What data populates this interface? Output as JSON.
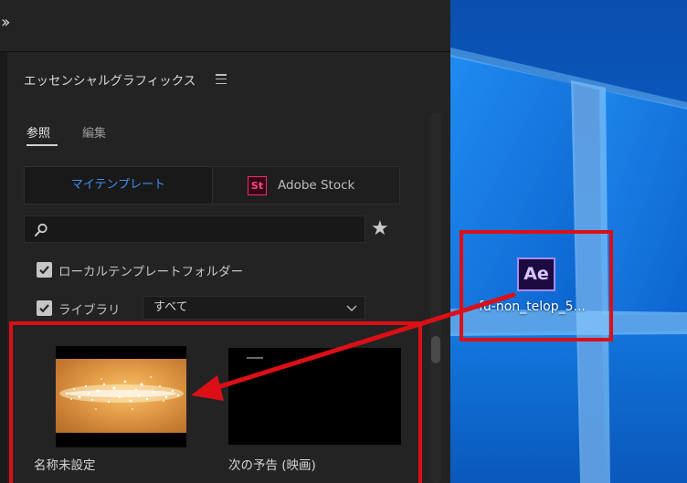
{
  "panel": {
    "title": "エッセンシャルグラフィックス",
    "tabs": {
      "browse": "参照",
      "edit": "編集"
    },
    "segment": {
      "mine": "マイテンプレート",
      "stock_badge": "St",
      "stock": "Adobe Stock"
    },
    "search": {
      "value": "",
      "placeholder": ""
    },
    "local_templates_label": "ローカルテンプレートフォルダー",
    "library_label": "ライブラリ",
    "library_dropdown": "すべて",
    "templates": [
      {
        "name": "名称未設定"
      },
      {
        "name": "次の予告 (映画)"
      }
    ]
  },
  "desktop": {
    "file_icon_text": "Ae",
    "file_name": "fu-non_telop_5..."
  },
  "colors": {
    "accent_blue": "#3f8ef5",
    "stock_pink": "#ea2f6b",
    "annotation_red": "#dc0f16",
    "ae_purple": "#a78bf3",
    "desktop_blue": "#0b60c9"
  },
  "icons": [
    "expand-chevrons-icon",
    "hamburger-menu-icon",
    "search-icon",
    "star-icon",
    "checkbox-checked-icon",
    "chevron-down-icon",
    "after-effects-icon"
  ]
}
